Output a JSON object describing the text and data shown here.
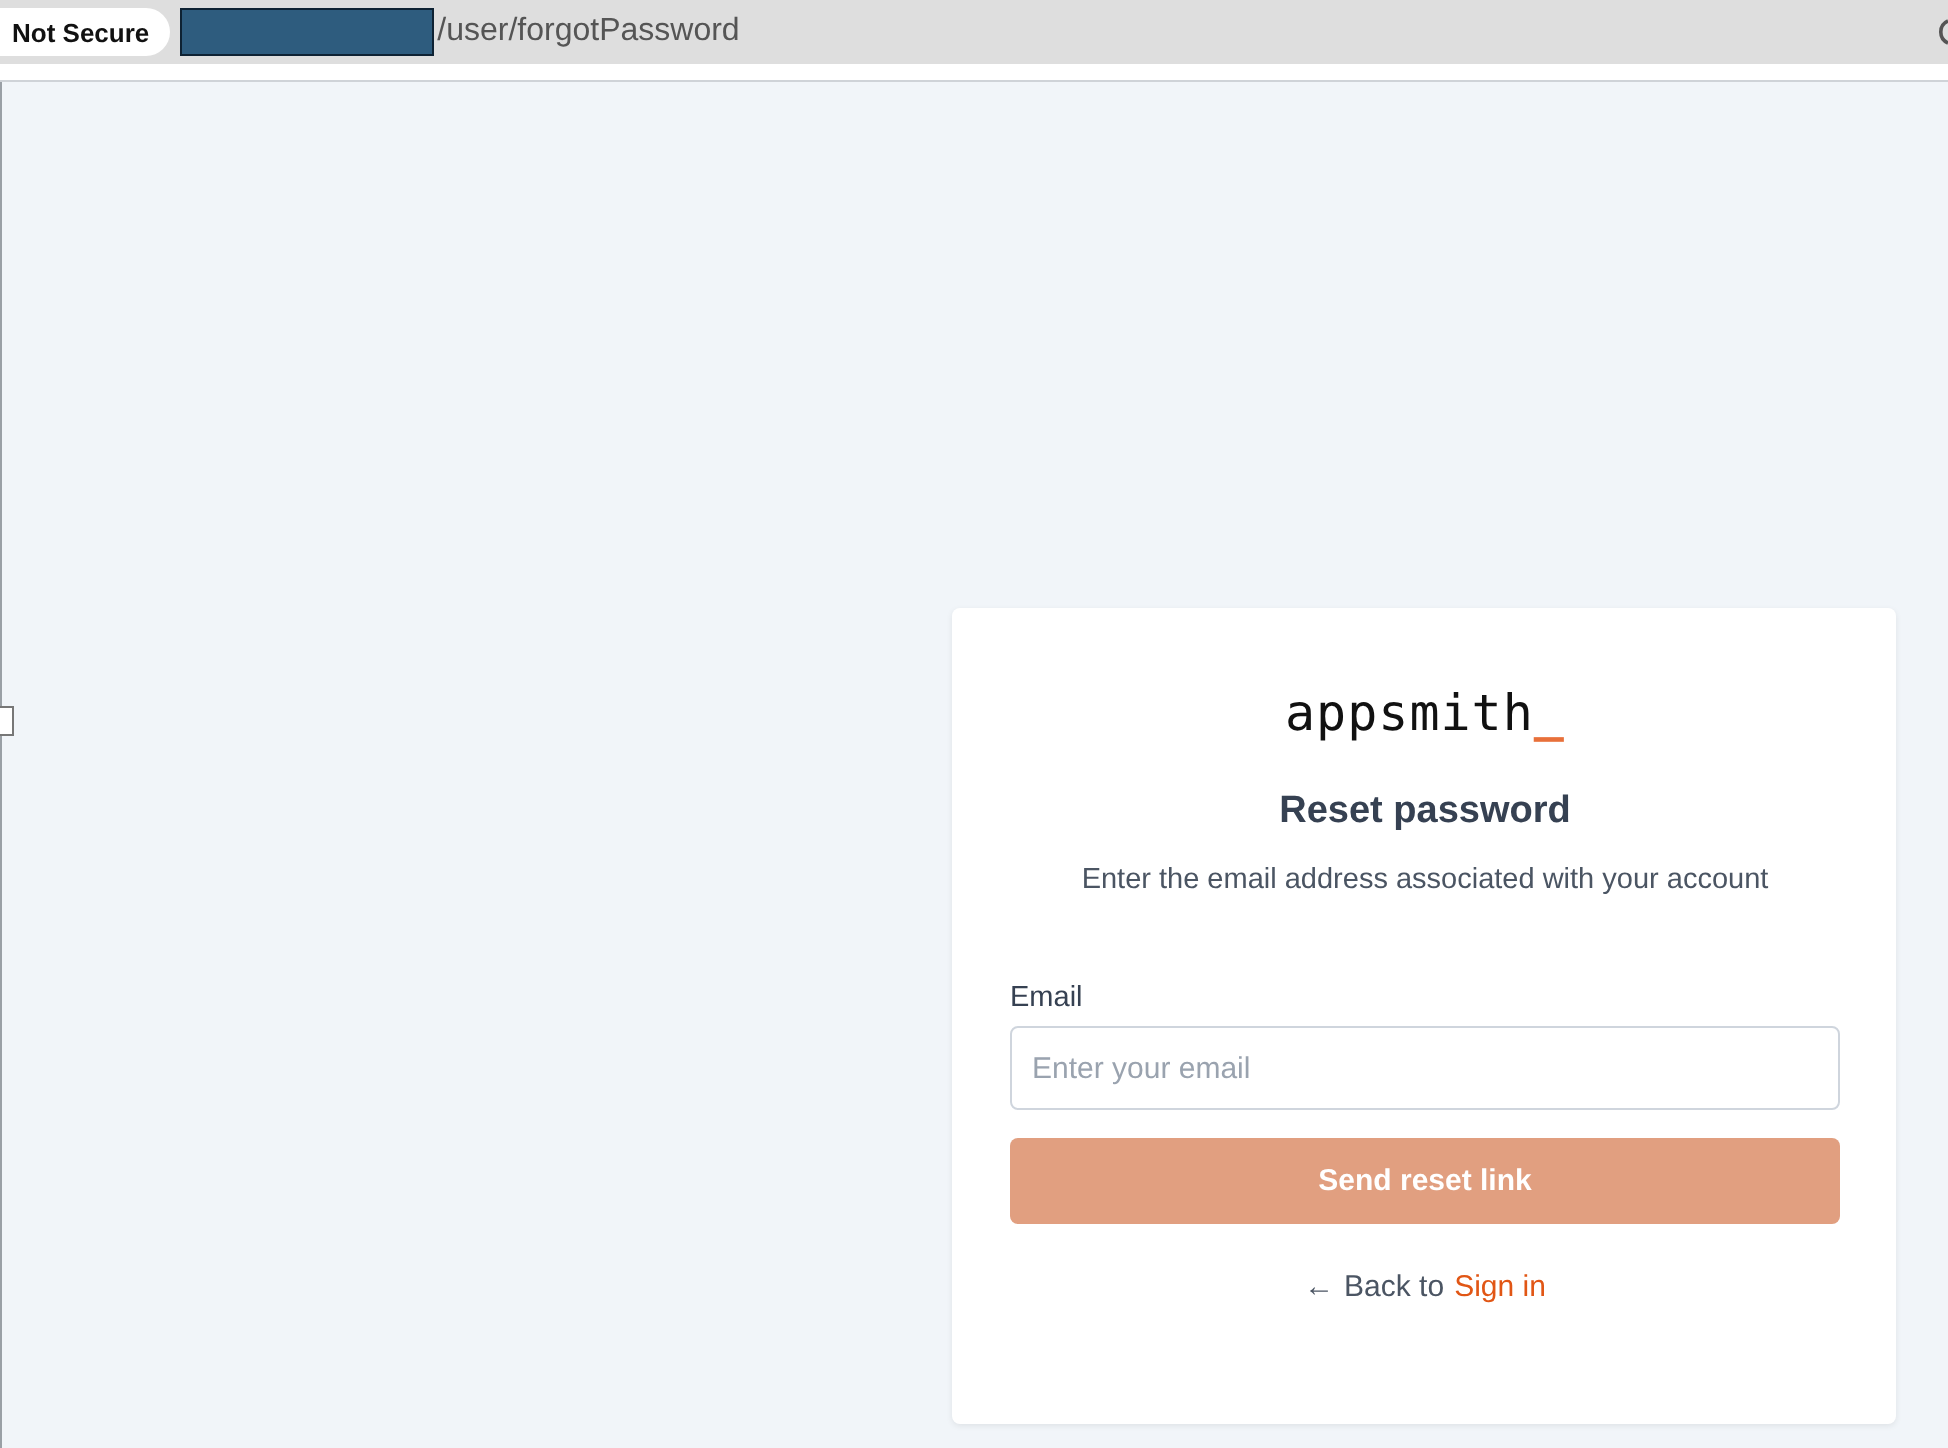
{
  "browser": {
    "security_label": "Not Secure",
    "url_redacted": true,
    "url": "/user/forgotPassword"
  },
  "card": {
    "logo": {
      "text": "appsmith",
      "cursor": "_"
    },
    "title": "Reset password",
    "subtitle": "Enter the email address associated with your account",
    "email": {
      "label": "Email",
      "placeholder": "Enter your email"
    },
    "submit": {
      "label": "Send reset link",
      "disabled": true
    },
    "back": {
      "arrow": "←",
      "text": "Back to",
      "link": "Sign in"
    }
  }
}
